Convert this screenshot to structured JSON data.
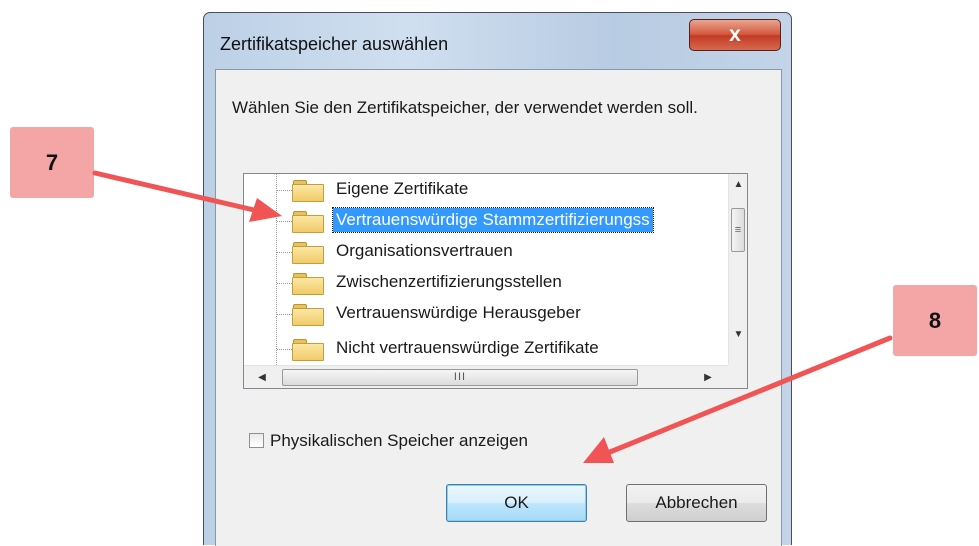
{
  "dialog": {
    "title": "Zertifikatspeicher auswählen",
    "close_label": "x",
    "instruction": "Wählen Sie den Zertifikatspeicher, der verwendet werden soll.",
    "stores": [
      {
        "label": "Eigene Zertifikate",
        "selected": false
      },
      {
        "label": "Vertrauenswürdige Stammzertifizierungss",
        "selected": true
      },
      {
        "label": "Organisationsvertrauen",
        "selected": false
      },
      {
        "label": "Zwischenzertifizierungsstellen",
        "selected": false
      },
      {
        "label": "Vertrauenswürdige Herausgeber",
        "selected": false
      },
      {
        "label": "Nicht vertrauenswürdige Zertifikate",
        "selected": false
      }
    ],
    "checkbox_label": "Physikalischen Speicher anzeigen",
    "checkbox_checked": false,
    "ok_label": "OK",
    "cancel_label": "Abbrechen"
  },
  "scrollbar_glyphs": {
    "up": "▲",
    "down": "▼",
    "left": "◀",
    "right": "▶",
    "v_grip": "≡",
    "h_grip": "III"
  },
  "annotations": {
    "step_7": "7",
    "step_8": "8",
    "arrow_color": "#f05454",
    "box_color": "#f4a6a6"
  },
  "colors": {
    "selection": "#3399ff",
    "close_button": "#c9452d"
  }
}
